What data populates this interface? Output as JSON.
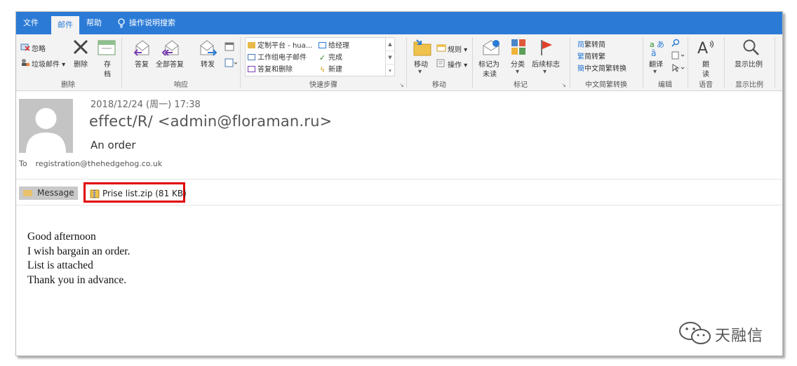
{
  "menu": {
    "tabs": [
      "文件",
      "邮件",
      "帮助"
    ],
    "active_tab": "邮件",
    "tell_me": "操作说明搜索"
  },
  "ribbon": {
    "delete_group": {
      "label": "删除",
      "ignore": "忽略",
      "junk": "垃圾邮件",
      "delete": "删除",
      "archive_line1": "存",
      "archive_line2": "档"
    },
    "respond_group": {
      "label": "响应",
      "reply": "答复",
      "reply_all": "全部答复",
      "forward": "转发"
    },
    "quicksteps_group": {
      "label": "快速步骤",
      "items": [
        "定制平台 - hua...",
        "工作组电子邮件",
        "答复和删除",
        "给经理",
        "完成",
        "新建"
      ]
    },
    "move_group": {
      "label": "移动",
      "move": "移动",
      "rules": "规则",
      "actions": "操作"
    },
    "tags_group": {
      "label": "标记",
      "mark_unread_line1": "标记为",
      "mark_unread_line2": "未读",
      "categorize": "分类",
      "follow_up": "后续标志"
    },
    "chinese_group": {
      "label": "中文简繁转换",
      "to_simplified": "繁转简",
      "to_traditional": "简转繁",
      "convert": "中文简繁转换"
    },
    "editing_group": {
      "label": "编辑",
      "translate": "翻译"
    },
    "speech_group": {
      "label": "语音",
      "read_line1": "朗",
      "read_line2": "读"
    },
    "zoom_group": {
      "label": "显示比例",
      "zoom": "显示比例"
    }
  },
  "message": {
    "date": "2018/12/24 (周一) 17:38",
    "sender": "effect/R/ <admin@floraman.ru>",
    "subject": "An order",
    "to_label": "To",
    "to": "registration@thehedgehog.co.uk",
    "message_tab": "Message",
    "attachment": "Prise list.zip (81 KB)",
    "body": [
      "Good afternoon",
      "I wish bargain an order.",
      "List is attached",
      "Thank you in advance."
    ]
  },
  "watermark": "天融信",
  "colors": {
    "accent": "#2b7bd6",
    "highlight_border": "#e00000",
    "ribbon_bg": "#f3f3f3"
  }
}
